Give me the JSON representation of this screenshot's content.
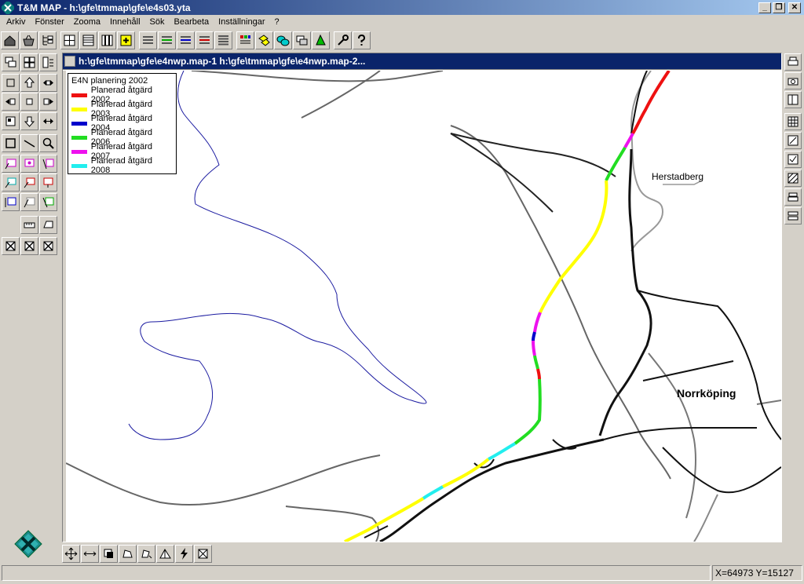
{
  "app": {
    "title": "T&M MAP - h:\\gfe\\tmmap\\gfe\\e4s03.yta",
    "minimize": "_",
    "restore": "❐",
    "close": "✕"
  },
  "menu": [
    "Arkiv",
    "Fönster",
    "Zooma",
    "Innehåll",
    "Sök",
    "Bearbeta",
    "Inställningar",
    "?"
  ],
  "map_window": {
    "title": "h:\\gfe\\tmmap\\gfe\\e4nwp.map-1 h:\\gfe\\tmmap\\gfe\\e4nwp.map-2..."
  },
  "legend": {
    "title": "E4N planering 2002",
    "items": [
      {
        "label": "Planerad åtgärd 2002",
        "color": "#ee1111"
      },
      {
        "label": "Planerad åtgärd 2003",
        "color": "#ffff00"
      },
      {
        "label": "Planerad åtgärd 2004",
        "color": "#0000cc"
      },
      {
        "label": "Planerad åtgärd 2006",
        "color": "#22dd22"
      },
      {
        "label": "Planerad åtgärd 2007",
        "color": "#ee11ee"
      },
      {
        "label": "Planerad åtgärd 2008",
        "color": "#22eeee"
      }
    ]
  },
  "places": {
    "herstadberg": "Herstadberg",
    "norrkoping": "Norrköping"
  },
  "status": {
    "coords": "X=64973  Y=15127"
  }
}
